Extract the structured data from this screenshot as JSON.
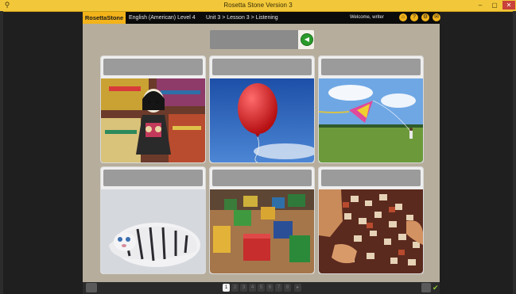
{
  "window": {
    "title": "Rosetta Stone Version 3",
    "min": "–",
    "max": "▢",
    "close": "✕"
  },
  "appbar": {
    "logo": "RosettaStone",
    "course": "English (American) Level 4",
    "breadcrumb": "Unit 3 > Lesson 3 > Listening",
    "welcome": "Welcome, writer"
  },
  "lesson": {
    "play_symbol": "◀",
    "cards": [
      {
        "subject": "folk doll"
      },
      {
        "subject": "red balloon"
      },
      {
        "subject": "kite"
      },
      {
        "subject": "stuffed tiger"
      },
      {
        "subject": "toy blocks"
      },
      {
        "subject": "puzzle"
      }
    ]
  },
  "pager": {
    "pages": [
      "1",
      "2",
      "3",
      "4",
      "5",
      "6",
      "7",
      "8"
    ],
    "current": "1"
  },
  "colors": {
    "brand": "#f3b31a",
    "titlebar": "#f2c83a",
    "stage": "#b6ad9c",
    "play": "#2a9a2a"
  }
}
